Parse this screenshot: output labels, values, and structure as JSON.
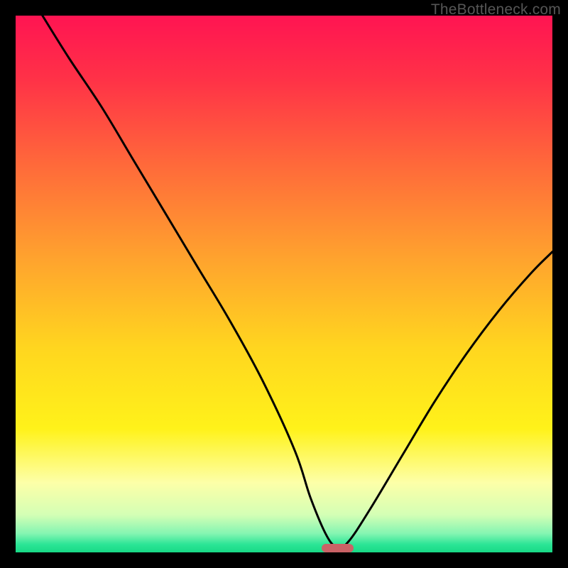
{
  "watermark": "TheBottleneck.com",
  "plot": {
    "inner_width": 756,
    "inner_height": 756
  },
  "chart_data": {
    "type": "line",
    "title": "",
    "xlabel": "",
    "ylabel": "",
    "xlim": [
      0,
      100
    ],
    "ylim": [
      0,
      100
    ],
    "series": [
      {
        "name": "bottleneck-curve",
        "x": [
          5,
          10,
          16,
          22,
          28,
          34,
          40,
          46,
          52,
          55,
          58,
          60,
          62,
          66,
          72,
          78,
          84,
          90,
          96,
          100
        ],
        "values": [
          100,
          92,
          83,
          73,
          63,
          53,
          43,
          32,
          19,
          10,
          3,
          1,
          2,
          8,
          18,
          28,
          37,
          45,
          52,
          56
        ]
      }
    ],
    "marker": {
      "x_center": 60,
      "x_width": 6,
      "y": 0.8
    },
    "gradient_stops": [
      {
        "offset": 0.0,
        "color": "#ff1452"
      },
      {
        "offset": 0.12,
        "color": "#ff3247"
      },
      {
        "offset": 0.28,
        "color": "#ff6a3a"
      },
      {
        "offset": 0.45,
        "color": "#ffa22e"
      },
      {
        "offset": 0.62,
        "color": "#ffd61f"
      },
      {
        "offset": 0.77,
        "color": "#fff21a"
      },
      {
        "offset": 0.87,
        "color": "#fdffa8"
      },
      {
        "offset": 0.93,
        "color": "#d4ffb5"
      },
      {
        "offset": 0.965,
        "color": "#84f5b2"
      },
      {
        "offset": 0.985,
        "color": "#2ce596"
      },
      {
        "offset": 1.0,
        "color": "#18d986"
      }
    ]
  }
}
